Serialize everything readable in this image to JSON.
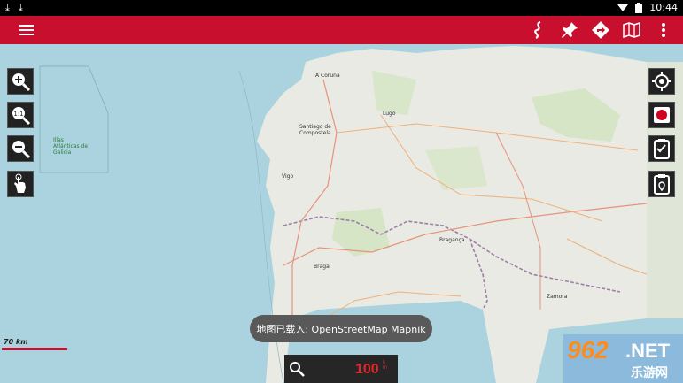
{
  "status_bar": {
    "time": "10:44"
  },
  "toolbar": {
    "menu_icon": "hamburger-menu-icon",
    "actions": [
      "route-icon",
      "pin-icon",
      "navigate-icon",
      "map-icon",
      "more-vert-icon"
    ]
  },
  "map": {
    "labels": {
      "vigo": "Vigo",
      "braga": "Braga",
      "bragança": "Bragança",
      "lugo": "Lugo",
      "zamora": "Zamora",
      "santiago": "Santiago de Compostela",
      "coruna": "A Coruña",
      "illas": "Illas Atlánticas de Galicia"
    },
    "scale": {
      "label": "70 km"
    }
  },
  "left_controls": [
    "zoom-in-icon",
    "zoom-reset-1-1-icon",
    "zoom-out-icon",
    "touch-hand-icon"
  ],
  "right_controls": [
    "gps-locate-icon",
    "record-icon",
    "checklist-icon",
    "location-list-icon"
  ],
  "toast": {
    "text": "地图已载入: OpenStreetMap Mapnik"
  },
  "bottom_panel": {
    "speed": "100",
    "unit": "km"
  },
  "watermark": {
    "brand": "962",
    "suffix": ".NET",
    "sub": "乐游网"
  },
  "colors": {
    "brand_red": "#c8102e",
    "sea": "#aad3df",
    "land": "#e9eae3"
  }
}
